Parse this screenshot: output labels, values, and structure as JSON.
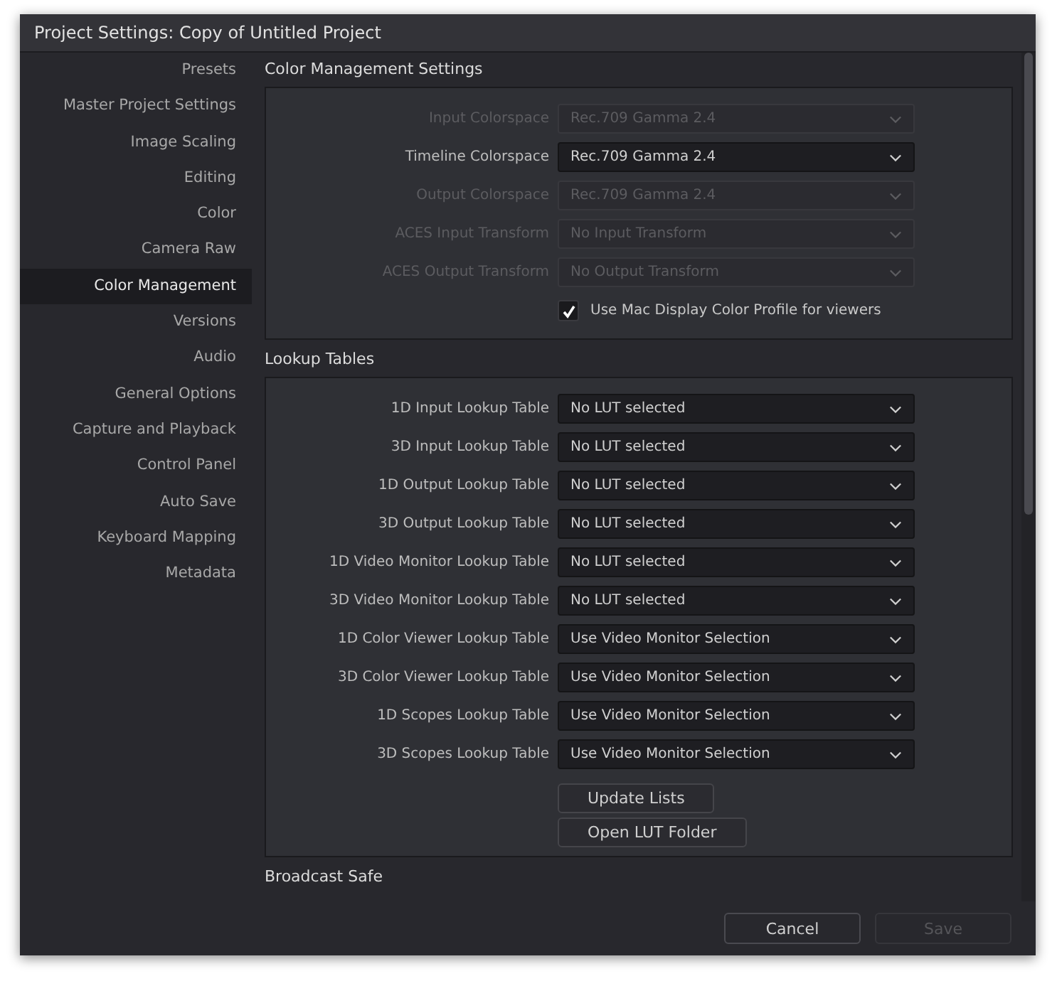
{
  "window": {
    "title": "Project Settings:  Copy of Untitled Project"
  },
  "sidebar": {
    "items": [
      {
        "label": "Presets",
        "selected": false
      },
      {
        "label": "Master Project Settings",
        "selected": false
      },
      {
        "label": "Image Scaling",
        "selected": false
      },
      {
        "label": "Editing",
        "selected": false
      },
      {
        "label": "Color",
        "selected": false
      },
      {
        "label": "Camera Raw",
        "selected": false
      },
      {
        "label": "Color Management",
        "selected": true
      },
      {
        "label": "Versions",
        "selected": false
      },
      {
        "label": "Audio",
        "selected": false
      },
      {
        "label": "General Options",
        "selected": false
      },
      {
        "label": "Capture and Playback",
        "selected": false
      },
      {
        "label": "Control Panel",
        "selected": false
      },
      {
        "label": "Auto Save",
        "selected": false
      },
      {
        "label": "Keyboard Mapping",
        "selected": false
      },
      {
        "label": "Metadata",
        "selected": false
      }
    ]
  },
  "sections": [
    {
      "title": "Color Management Settings",
      "rows": [
        {
          "label": "Input Colorspace",
          "value": "Rec.709 Gamma 2.4",
          "disabled": true
        },
        {
          "label": "Timeline Colorspace",
          "value": "Rec.709 Gamma 2.4",
          "disabled": false
        },
        {
          "label": "Output Colorspace",
          "value": "Rec.709 Gamma 2.4",
          "disabled": true
        },
        {
          "label": "ACES Input Transform",
          "value": "No Input Transform",
          "disabled": true
        },
        {
          "label": "ACES Output Transform",
          "value": "No Output Transform",
          "disabled": true
        }
      ],
      "checkbox": {
        "label": "Use Mac Display Color Profile for viewers",
        "checked": true
      }
    },
    {
      "title": "Lookup Tables",
      "rows": [
        {
          "label": "1D Input Lookup Table",
          "value": "No LUT selected",
          "disabled": false
        },
        {
          "label": "3D Input Lookup Table",
          "value": "No LUT selected",
          "disabled": false
        },
        {
          "label": "1D Output Lookup Table",
          "value": "No LUT selected",
          "disabled": false
        },
        {
          "label": "3D Output Lookup Table",
          "value": "No LUT selected",
          "disabled": false
        },
        {
          "label": "1D Video Monitor Lookup Table",
          "value": "No LUT selected",
          "disabled": false
        },
        {
          "label": "3D Video Monitor Lookup Table",
          "value": "No LUT selected",
          "disabled": false
        },
        {
          "label": "1D Color Viewer Lookup Table",
          "value": "Use Video Monitor Selection",
          "disabled": false
        },
        {
          "label": "3D Color Viewer Lookup Table",
          "value": "Use Video Monitor Selection",
          "disabled": false
        },
        {
          "label": "1D Scopes Lookup Table",
          "value": "Use Video Monitor Selection",
          "disabled": false
        },
        {
          "label": "3D Scopes Lookup Table",
          "value": "Use Video Monitor Selection",
          "disabled": false
        }
      ],
      "buttons": [
        "Update Lists",
        "Open LUT Folder"
      ]
    },
    {
      "title": "Broadcast Safe"
    }
  ],
  "footer": {
    "buttons": [
      {
        "label": "Cancel",
        "disabled": false
      },
      {
        "label": "Save",
        "disabled": true
      }
    ]
  }
}
